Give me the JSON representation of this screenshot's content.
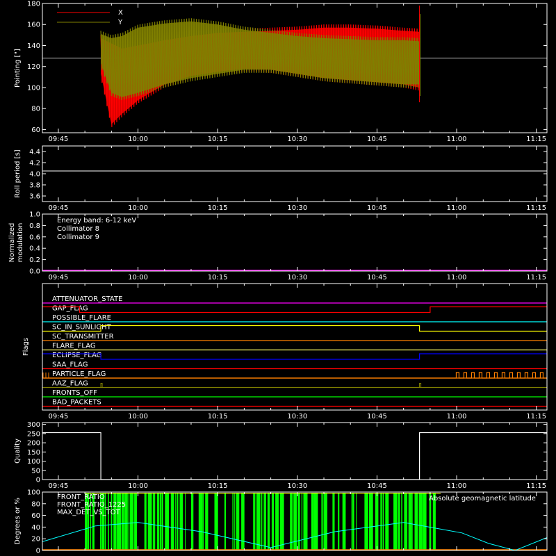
{
  "time_ticks": [
    "09:45",
    "10:00",
    "10:15",
    "10:30",
    "10:45",
    "11:00",
    "11:15"
  ],
  "panels": {
    "pointing": {
      "ylabel": "Pointing [\"]",
      "yticks": [
        60,
        80,
        100,
        120,
        140,
        160,
        180
      ],
      "ylim": [
        57,
        180
      ],
      "legend": [
        {
          "name": "X",
          "color": "#ff0000"
        },
        {
          "name": "Y",
          "color": "#808000"
        }
      ],
      "reference_line": 128,
      "data_start": "09:53",
      "data_end": "10:53",
      "x_series": {
        "name": "X",
        "color": "#ff0000",
        "times": [
          "09:53",
          "09:55",
          "09:57",
          "10:00",
          "10:05",
          "10:10",
          "10:15",
          "10:20",
          "10:25",
          "10:30",
          "10:35",
          "10:40",
          "10:45",
          "10:50",
          "10:53"
        ],
        "upper": [
          150,
          145,
          140,
          143,
          148,
          152,
          155,
          156,
          157,
          158,
          160,
          160,
          159,
          157,
          156
        ],
        "lower": [
          110,
          62,
          72,
          85,
          100,
          108,
          112,
          115,
          114,
          110,
          106,
          104,
          102,
          100,
          97
        ]
      },
      "y_series": {
        "name": "Y",
        "color": "#808000",
        "times": [
          "09:53",
          "09:55",
          "09:57",
          "10:00",
          "10:05",
          "10:10",
          "10:15",
          "10:20",
          "10:25",
          "10:30",
          "10:35",
          "10:40",
          "10:45",
          "10:50",
          "10:53"
        ],
        "upper": [
          154,
          150,
          152,
          160,
          164,
          166,
          163,
          158,
          155,
          152,
          150,
          149,
          148,
          148,
          147
        ],
        "lower": [
          120,
          92,
          88,
          92,
          100,
          106,
          110,
          114,
          114,
          110,
          106,
          104,
          102,
          100,
          100
        ]
      }
    },
    "roll": {
      "ylabel": "Roll period [s]",
      "yticks": [
        3.6,
        3.8,
        4.0,
        4.2,
        4.4
      ],
      "ylim": [
        3.5,
        4.5
      ],
      "value": 4.05,
      "color": "#ffffff"
    },
    "modulation": {
      "ylabel_line1": "Normalized",
      "ylabel_line2": "modulation",
      "yticks": [
        0.0,
        0.2,
        0.4,
        0.6,
        0.8,
        1.0
      ],
      "ylim": [
        0,
        1
      ],
      "legend": [
        {
          "name": "Energy band: 6-12 keV",
          "color": "#ffffff"
        },
        {
          "name": "Collimator 8",
          "color": "#00ffff"
        },
        {
          "name": "Collimator 9",
          "color": "#ff00ff"
        }
      ],
      "baseline_color": "#ff00ff"
    },
    "flags": {
      "ylabel": "Flags",
      "items": [
        {
          "name": "ATTENUATOR_STATE",
          "color": "#ff00ff",
          "steps": []
        },
        {
          "name": "GAP_FLAG",
          "color": "#ff0000",
          "steps": [
            {
              "from": "09:42",
              "to": "09:49",
              "high": true
            },
            {
              "from": "09:49",
              "to": "10:55",
              "high": false
            },
            {
              "from": "10:55",
              "to": "11:17",
              "high": true
            }
          ]
        },
        {
          "name": "POSSIBLE_FLARE",
          "color": "#00ffff",
          "steps": []
        },
        {
          "name": "SC_IN_SUNLIGHT",
          "color": "#ffff00",
          "steps": [
            {
              "from": "09:42",
              "to": "09:53",
              "high": false
            },
            {
              "from": "09:53",
              "to": "10:53",
              "high": true
            },
            {
              "from": "10:53",
              "to": "11:17",
              "high": false
            }
          ]
        },
        {
          "name": "SC_TRANSMITTER",
          "color": "#ff8000",
          "steps": []
        },
        {
          "name": "FLARE_FLAG",
          "color": "#ffff66",
          "steps": []
        },
        {
          "name": "ECLIPSE_FLAG",
          "color": "#0000ff",
          "steps": [
            {
              "from": "09:42",
              "to": "09:53",
              "high": true
            },
            {
              "from": "09:53",
              "to": "10:53",
              "high": false
            },
            {
              "from": "10:53",
              "to": "11:17",
              "high": true
            }
          ]
        },
        {
          "name": "SAA_FLAG",
          "color": "#ff0000",
          "steps": []
        },
        {
          "name": "PARTICLE_FLAG",
          "color": "#ff8000",
          "steps": []
        },
        {
          "name": "AAZ_FLAG",
          "color": "#808000",
          "steps": []
        },
        {
          "name": "FRONTS_OFF",
          "color": "#00ff00",
          "steps": []
        },
        {
          "name": "BAD_PACKETS",
          "color": "#ff0000",
          "steps": []
        }
      ]
    },
    "quality": {
      "ylabel": "Quality",
      "yticks": [
        0,
        50,
        100,
        150,
        200,
        250,
        300
      ],
      "ylim": [
        0,
        310
      ],
      "steps": [
        {
          "from": "09:42",
          "to": "09:53",
          "value": 255
        },
        {
          "from": "09:53",
          "to": "10:53",
          "value": 0
        },
        {
          "from": "10:53",
          "to": "11:17",
          "value": 255
        }
      ]
    },
    "ratios": {
      "ylabel": "Degrees or %",
      "yticks": [
        0,
        20,
        40,
        60,
        80,
        100
      ],
      "ylim": [
        0,
        100
      ],
      "legend_left": [
        {
          "name": "FRONT_RATIO",
          "color": "#ffff00"
        },
        {
          "name": "FRONT_RATIO_1225",
          "color": "#00ff00"
        },
        {
          "name": "MAX_DET_VS_TOT",
          "color": "#ff8000"
        }
      ],
      "legend_right": {
        "name": "Absolute geomagnetic latitude",
        "color": "#00ffff"
      },
      "geomag": {
        "times": [
          "09:42",
          "09:52",
          "10:00",
          "10:12",
          "10:25",
          "10:37",
          "10:50",
          "11:01",
          "11:06",
          "11:11",
          "11:17"
        ],
        "values": [
          15,
          42,
          48,
          32,
          5,
          32,
          48,
          30,
          12,
          0,
          22
        ]
      },
      "green_start": "09:50",
      "green_end": "10:57"
    }
  }
}
